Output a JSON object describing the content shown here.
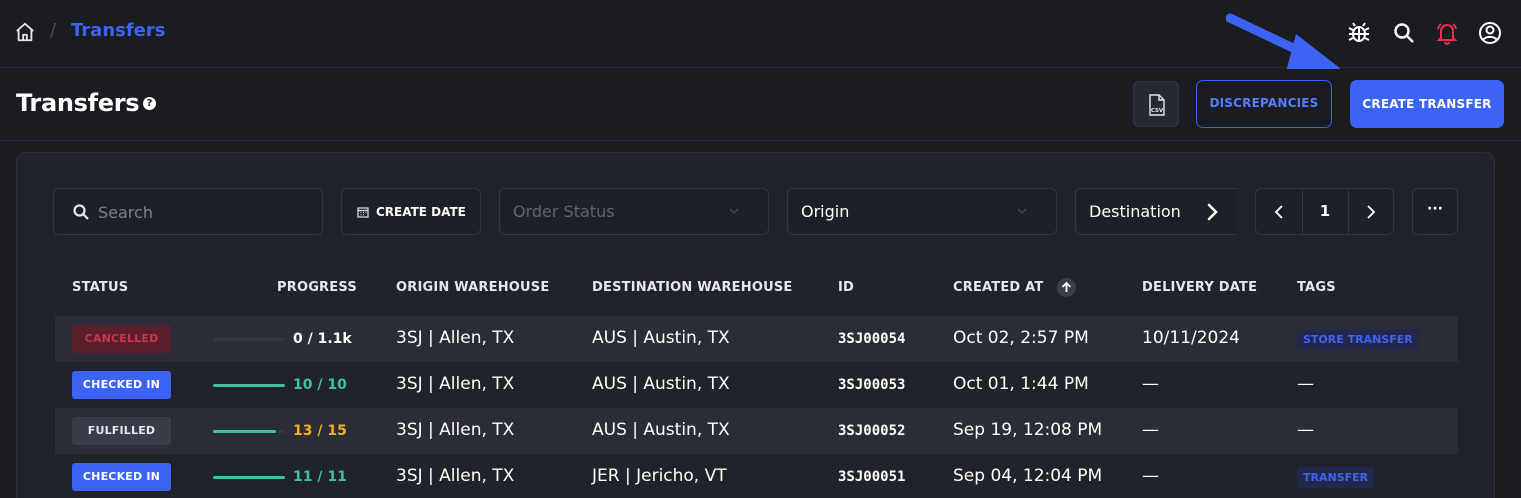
{
  "breadcrumb": {
    "separator": "/",
    "current": "Transfers"
  },
  "header": {
    "title": "Transfers",
    "help": "?",
    "csv_label": "CSV",
    "discrepancies_label": "DISCREPANCIES",
    "create_label": "CREATE TRANSFER"
  },
  "filters": {
    "search_placeholder": "Search",
    "create_date_label": "CREATE DATE",
    "order_status_placeholder": "Order Status",
    "origin_label": "Origin",
    "destination_label": "Destination"
  },
  "pagination": {
    "page": "1",
    "more": "···"
  },
  "table": {
    "headers": {
      "status": "STATUS",
      "progress": "PROGRESS",
      "origin": "ORIGIN WAREHOUSE",
      "destination": "DESTINATION WAREHOUSE",
      "id": "ID",
      "created": "CREATED AT",
      "delivery": "DELIVERY DATE",
      "tags": "TAGS"
    },
    "rows": [
      {
        "status": "CANCELLED",
        "progress_text": "0 / 1.1k",
        "progress": 0,
        "origin": "3SJ | Allen, TX",
        "destination": "AUS | Austin, TX",
        "id": "3SJ00054",
        "created": "Oct 02, 2:57 PM",
        "delivery": "10/11/2024",
        "tag": "STORE TRANSFER"
      },
      {
        "status": "CHECKED IN",
        "progress_text": "10 / 10",
        "progress": 1,
        "origin": "3SJ | Allen, TX",
        "destination": "AUS | Austin, TX",
        "id": "3SJ00053",
        "created": "Oct 01, 1:44 PM",
        "delivery": "—",
        "tag": "—"
      },
      {
        "status": "FULFILLED",
        "progress_text": "13 / 15",
        "progress": 0.87,
        "origin": "3SJ | Allen, TX",
        "destination": "AUS | Austin, TX",
        "id": "3SJ00052",
        "created": "Sep 19, 12:08 PM",
        "delivery": "—",
        "tag": "—"
      },
      {
        "status": "CHECKED IN",
        "progress_text": "11 / 11",
        "progress": 1,
        "origin": "3SJ | Allen, TX",
        "destination": "JER | Jericho, VT",
        "id": "3SJ00051",
        "created": "Sep 04, 12:04 PM",
        "delivery": "—",
        "tag": "TRANSFER"
      }
    ]
  },
  "colors": {
    "accent": "#3d63f5",
    "cancelled_bg": "#5a1f2b",
    "cancelled_fg": "#c8354f",
    "checked_bg": "#3d63f5",
    "checked_fg": "#ffffff",
    "fulfilled_bg": "#3a3d47",
    "fulfilled_fg": "#e6e8ee",
    "progress_green": "#3fc39a",
    "progress_amber": "#f2b01e"
  }
}
